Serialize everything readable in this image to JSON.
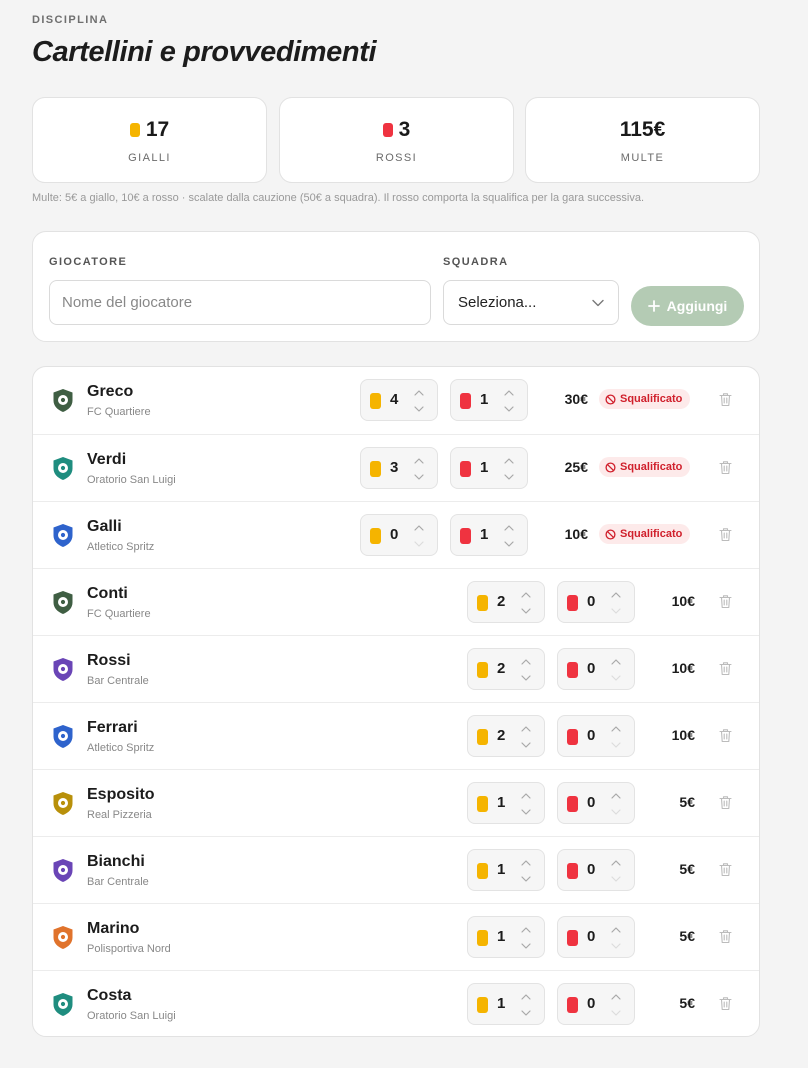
{
  "header": {
    "eyebrow": "DISCIPLINA",
    "title": "Cartellini e provvedimenti"
  },
  "stats": [
    {
      "value": "17",
      "label": "GIALLI",
      "card": "yellow"
    },
    {
      "value": "3",
      "label": "ROSSI",
      "card": "red"
    },
    {
      "value": "115€",
      "label": "MULTE",
      "card": "none"
    }
  ],
  "note": "Multe: 5€ a giallo, 10€ a rosso · scalate dalla cauzione (50€ a squadra). Il rosso comporta la squalifica per la gara successiva.",
  "form": {
    "player_label": "GIOCATORE",
    "player_placeholder": "Nome del giocatore",
    "team_label": "SQUADRA",
    "team_selected": "Seleziona...",
    "add_label": "Aggiungi"
  },
  "badge_label": "Squalificato",
  "colors": {
    "yellow": "#f5b400",
    "red": "#ef3340",
    "accent_disabled": "#b4cbb4",
    "badge_bg": "#fdeaea",
    "badge_text": "#d0202c"
  },
  "players": [
    {
      "name": "Greco",
      "team": "FC Quartiere",
      "yellow": "4",
      "red": "1",
      "fine": "30€",
      "suspended": true,
      "shield": "#3f5e43"
    },
    {
      "name": "Verdi",
      "team": "Oratorio San Luigi",
      "yellow": "3",
      "red": "1",
      "fine": "25€",
      "suspended": true,
      "shield": "#1f8d7f"
    },
    {
      "name": "Galli",
      "team": "Atletico Spritz",
      "yellow": "0",
      "red": "1",
      "fine": "10€",
      "suspended": true,
      "shield": "#2e63cc"
    },
    {
      "name": "Conti",
      "team": "FC Quartiere",
      "yellow": "2",
      "red": "0",
      "fine": "10€",
      "suspended": false,
      "shield": "#3f5e43"
    },
    {
      "name": "Rossi",
      "team": "Bar Centrale",
      "yellow": "2",
      "red": "0",
      "fine": "10€",
      "suspended": false,
      "shield": "#6a45b6"
    },
    {
      "name": "Ferrari",
      "team": "Atletico Spritz",
      "yellow": "2",
      "red": "0",
      "fine": "10€",
      "suspended": false,
      "shield": "#2e63cc"
    },
    {
      "name": "Esposito",
      "team": "Real Pizzeria",
      "yellow": "1",
      "red": "0",
      "fine": "5€",
      "suspended": false,
      "shield": "#b8900a"
    },
    {
      "name": "Bianchi",
      "team": "Bar Centrale",
      "yellow": "1",
      "red": "0",
      "fine": "5€",
      "suspended": false,
      "shield": "#6a45b6"
    },
    {
      "name": "Marino",
      "team": "Polisportiva Nord",
      "yellow": "1",
      "red": "0",
      "fine": "5€",
      "suspended": false,
      "shield": "#e0732c"
    },
    {
      "name": "Costa",
      "team": "Oratorio San Luigi",
      "yellow": "1",
      "red": "0",
      "fine": "5€",
      "suspended": false,
      "shield": "#1f8d7f"
    }
  ]
}
